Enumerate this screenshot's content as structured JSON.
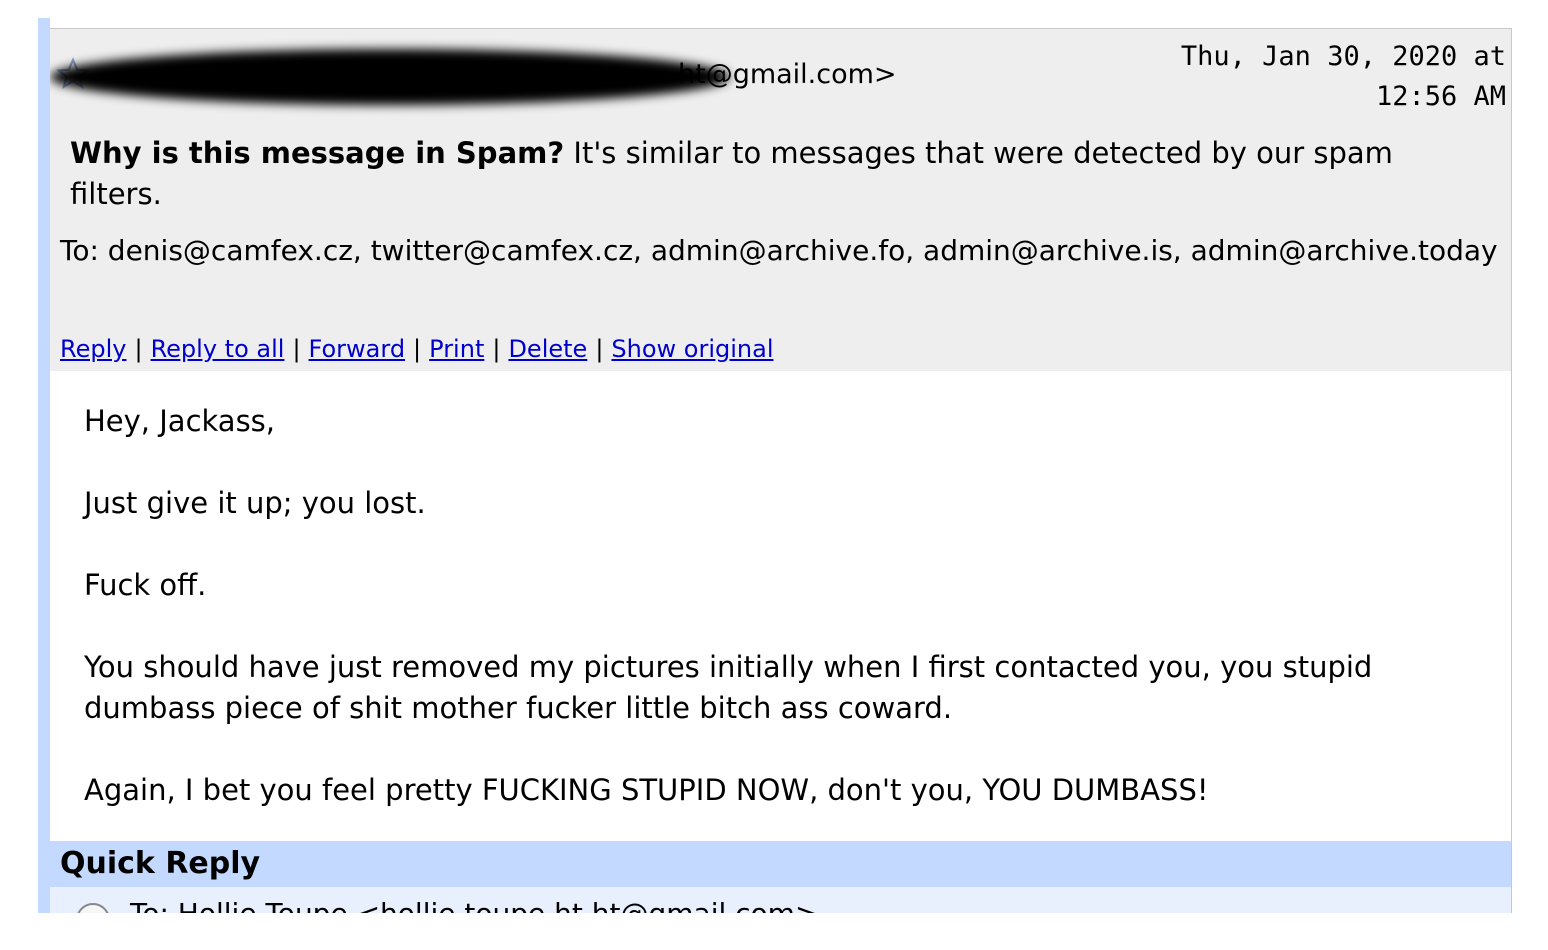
{
  "message": {
    "from_visible": "ht@gmail.com>",
    "date": "Thu, Jan 30, 2020 at 12:56 AM",
    "spam_notice": {
      "bold": "Why is this message in Spam?",
      "text": " It's similar to messages that were detected by our spam filters."
    },
    "to": "To: denis@camfex.cz, twitter@camfex.cz, admin@archive.fo, admin@archive.is, admin@archive.today",
    "actions": {
      "reply": "Reply",
      "reply_all": "Reply to all",
      "forward": "Forward",
      "print": "Print",
      "delete": "Delete",
      "show_original": "Show original",
      "separator": "|"
    },
    "body": [
      "Hey, Jackass,",
      "Just give it up; you lost.",
      "Fuck off.",
      "You should have just removed my pictures initially when I first contacted you, you stupid dumbass piece of shit mother fucker little bitch ass coward.",
      "Again, I bet you feel pretty FUCKING STUPID NOW, don't you, YOU DUMBASS!"
    ]
  },
  "quick_reply": {
    "title": "Quick Reply",
    "to": "To: Hollie Toupe <hollie.toupe.ht.ht@gmail.com>"
  }
}
